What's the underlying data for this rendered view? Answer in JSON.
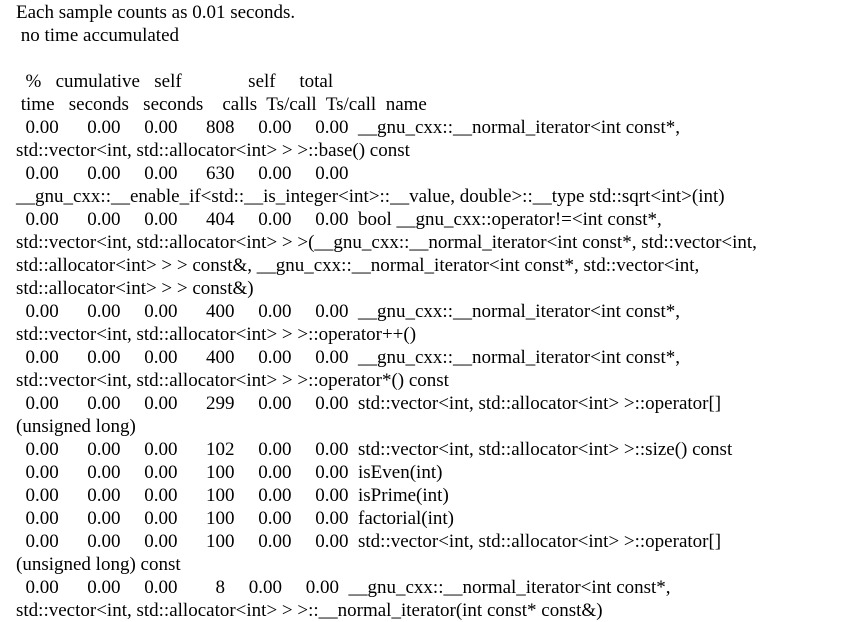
{
  "lines": [
    "Each sample counts as 0.01 seconds.",
    " no time accumulated",
    "",
    "  %   cumulative   self              self     total",
    " time   seconds   seconds    calls  Ts/call  Ts/call  name",
    "  0.00      0.00     0.00      808     0.00     0.00  __gnu_cxx::__normal_iterator<int const*,",
    "std::vector<int, std::allocator<int> > >::base() const",
    "  0.00      0.00     0.00      630     0.00     0.00",
    "__gnu_cxx::__enable_if<std::__is_integer<int>::__value, double>::__type std::sqrt<int>(int)",
    "  0.00      0.00     0.00      404     0.00     0.00  bool __gnu_cxx::operator!=<int const*,",
    "std::vector<int, std::allocator<int> > >(__gnu_cxx::__normal_iterator<int const*, std::vector<int,",
    "std::allocator<int> > > const&, __gnu_cxx::__normal_iterator<int const*, std::vector<int,",
    "std::allocator<int> > > const&)",
    "  0.00      0.00     0.00      400     0.00     0.00  __gnu_cxx::__normal_iterator<int const*,",
    "std::vector<int, std::allocator<int> > >::operator++()",
    "  0.00      0.00     0.00      400     0.00     0.00  __gnu_cxx::__normal_iterator<int const*,",
    "std::vector<int, std::allocator<int> > >::operator*() const",
    "  0.00      0.00     0.00      299     0.00     0.00  std::vector<int, std::allocator<int> >::operator[]",
    "(unsigned long)",
    "  0.00      0.00     0.00      102     0.00     0.00  std::vector<int, std::allocator<int> >::size() const",
    "  0.00      0.00     0.00      100     0.00     0.00  isEven(int)",
    "  0.00      0.00     0.00      100     0.00     0.00  isPrime(int)",
    "  0.00      0.00     0.00      100     0.00     0.00  factorial(int)",
    "  0.00      0.00     0.00      100     0.00     0.00  std::vector<int, std::allocator<int> >::operator[]",
    "(unsigned long) const",
    "  0.00      0.00     0.00        8     0.00     0.00  __gnu_cxx::__normal_iterator<int const*,",
    "std::vector<int, std::allocator<int> > >::__normal_iterator(int const* const&)"
  ]
}
